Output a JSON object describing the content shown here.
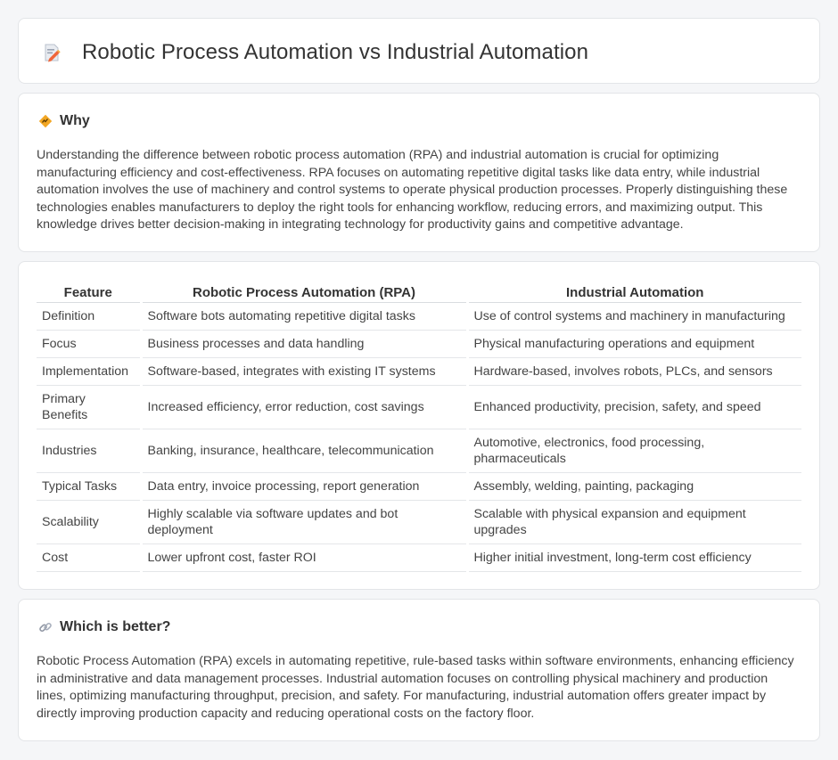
{
  "header": {
    "title": "Robotic Process Automation vs Industrial Automation",
    "icon": "document-pen-icon"
  },
  "why": {
    "icon": "diamond-sign-icon",
    "heading": "Why",
    "text": "Understanding the difference between robotic process automation (RPA) and industrial automation is crucial for optimizing manufacturing efficiency and cost-effectiveness. RPA focuses on automating repetitive digital tasks like data entry, while industrial automation involves the use of machinery and control systems to operate physical production processes. Properly distinguishing these technologies enables manufacturers to deploy the right tools for enhancing workflow, reducing errors, and maximizing output. This knowledge drives better decision-making in integrating technology for productivity gains and competitive advantage."
  },
  "table": {
    "headers": [
      "Feature",
      "Robotic Process Automation (RPA)",
      "Industrial Automation"
    ],
    "rows": [
      [
        "Definition",
        "Software bots automating repetitive digital tasks",
        "Use of control systems and machinery in manufacturing"
      ],
      [
        "Focus",
        "Business processes and data handling",
        "Physical manufacturing operations and equipment"
      ],
      [
        "Implementation",
        "Software-based, integrates with existing IT systems",
        "Hardware-based, involves robots, PLCs, and sensors"
      ],
      [
        "Primary Benefits",
        "Increased efficiency, error reduction, cost savings",
        "Enhanced productivity, precision, safety, and speed"
      ],
      [
        "Industries",
        "Banking, insurance, healthcare, telecommunication",
        "Automotive, electronics, food processing, pharmaceuticals"
      ],
      [
        "Typical Tasks",
        "Data entry, invoice processing, report generation",
        "Assembly, welding, painting, packaging"
      ],
      [
        "Scalability",
        "Highly scalable via software updates and bot deployment",
        "Scalable with physical expansion and equipment upgrades"
      ],
      [
        "Cost",
        "Lower upfront cost, faster ROI",
        "Higher initial investment, long-term cost efficiency"
      ]
    ]
  },
  "better": {
    "icon": "link-icon",
    "heading": "Which is better?",
    "text": "Robotic Process Automation (RPA) excels in automating repetitive, rule-based tasks within software environments, enhancing efficiency in administrative and data management processes. Industrial automation focuses on controlling physical machinery and production lines, optimizing manufacturing throughput, precision, and safety. For manufacturing, industrial automation offers greater impact by directly improving production capacity and reducing operational costs on the factory floor."
  }
}
